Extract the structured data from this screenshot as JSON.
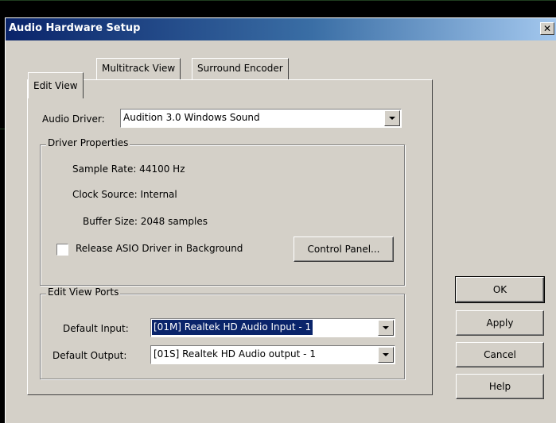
{
  "window": {
    "title": "Audio Hardware Setup",
    "close_glyph": "✕"
  },
  "tabs": [
    {
      "label": "Edit View",
      "active": true
    },
    {
      "label": "Multitrack View",
      "active": false
    },
    {
      "label": "Surround Encoder",
      "active": false
    }
  ],
  "audio_driver": {
    "label": "Audio Driver:",
    "value": "Audition 3.0 Windows Sound"
  },
  "driver_properties": {
    "title": "Driver Properties",
    "sample_rate": "Sample Rate: 44100 Hz",
    "clock_source": "Clock Source: Internal",
    "buffer_size": "Buffer Size: 2048 samples",
    "release_asio_label": "Release ASIO Driver in Background",
    "release_asio_checked": false,
    "control_panel_label": "Control Panel..."
  },
  "ports": {
    "title": "Edit View Ports",
    "default_input_label": "Default Input:",
    "default_input_value": "[01M] Realtek HD Audio Input - 1",
    "default_output_label": "Default Output:",
    "default_output_value": "[01S] Realtek HD Audio output - 1"
  },
  "buttons": {
    "ok": "OK",
    "apply": "Apply",
    "cancel": "Cancel",
    "help": "Help"
  },
  "colors": {
    "title_start": "#0a246a",
    "title_end": "#a6caf0",
    "face": "#d4d0c8",
    "selection": "#0a246a"
  }
}
